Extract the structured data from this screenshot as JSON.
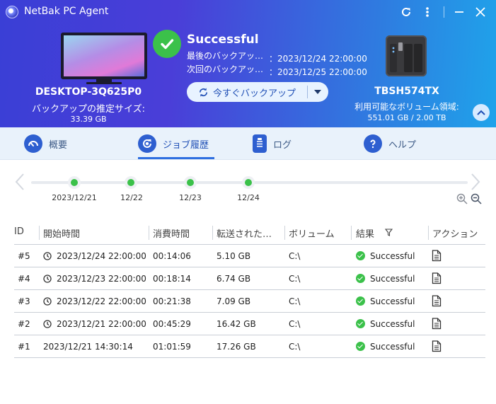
{
  "window": {
    "title": "NetBak PC Agent",
    "accent": "#2f6fe0",
    "success_color": "#3bc14a"
  },
  "pc": {
    "name": "DESKTOP-3Q625P0",
    "estimate_label": "バックアップの推定サイズ:",
    "estimate_value": "33.39 GB"
  },
  "status": {
    "title": "Successful",
    "last_label": "最後のバックアッ…",
    "last_value": "：2023/12/24 22:00:00",
    "next_label": "次回のバックアッ…",
    "next_value": "：2023/12/25 22:00:00",
    "backup_now_label": "今すぐバックアップ"
  },
  "nas": {
    "name": "TBSH574TX",
    "free_label": "利用可能なボリューム領域:",
    "free_value": "551.01 GB / 2.00 TB"
  },
  "tabs": [
    {
      "label": "概要",
      "icon": "gauge-icon"
    },
    {
      "label": "ジョブ履歴",
      "icon": "history-icon",
      "active": true
    },
    {
      "label": "ログ",
      "icon": "clipboard-icon"
    },
    {
      "label": "ヘルプ",
      "icon": "help-icon"
    }
  ],
  "timeline": {
    "dates": [
      "2023/12/21",
      "12/22",
      "12/23",
      "12/24"
    ]
  },
  "table": {
    "columns": [
      "ID",
      "開始時間",
      "消費時間",
      "転送された…",
      "ボリューム",
      "結果",
      "アクション"
    ],
    "rows": [
      {
        "id": "#5",
        "start": "2023/12/24 22:00:00",
        "scheduled": true,
        "duration": "00:14:06",
        "transferred": "5.10 GB",
        "volume": "C:\\",
        "result": "Successful"
      },
      {
        "id": "#4",
        "start": "2023/12/23 22:00:00",
        "scheduled": true,
        "duration": "00:18:14",
        "transferred": "6.74 GB",
        "volume": "C:\\",
        "result": "Successful"
      },
      {
        "id": "#3",
        "start": "2023/12/22 22:00:00",
        "scheduled": true,
        "duration": "00:21:38",
        "transferred": "7.09 GB",
        "volume": "C:\\",
        "result": "Successful"
      },
      {
        "id": "#2",
        "start": "2023/12/21 22:00:00",
        "scheduled": true,
        "duration": "00:45:29",
        "transferred": "16.42 GB",
        "volume": "C:\\",
        "result": "Successful"
      },
      {
        "id": "#1",
        "start": "2023/12/21 14:30:14",
        "scheduled": false,
        "duration": "01:01:59",
        "transferred": "17.26 GB",
        "volume": "C:\\",
        "result": "Successful"
      }
    ]
  }
}
